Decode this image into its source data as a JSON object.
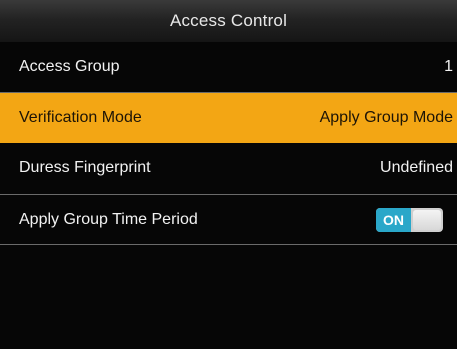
{
  "header": {
    "title": "Access Control"
  },
  "menu": {
    "items": [
      {
        "label": "Access Group",
        "value": "1"
      },
      {
        "label": "Verification Mode",
        "value": "Apply Group Mode"
      },
      {
        "label": "Duress Fingerprint",
        "value": "Undefined"
      },
      {
        "label": "Apply Group Time Period",
        "toggle": "ON"
      }
    ],
    "selected_index": 1
  },
  "colors": {
    "highlight": "#f3a614",
    "toggle_on": "#2aa7c9",
    "background": "#060606"
  }
}
